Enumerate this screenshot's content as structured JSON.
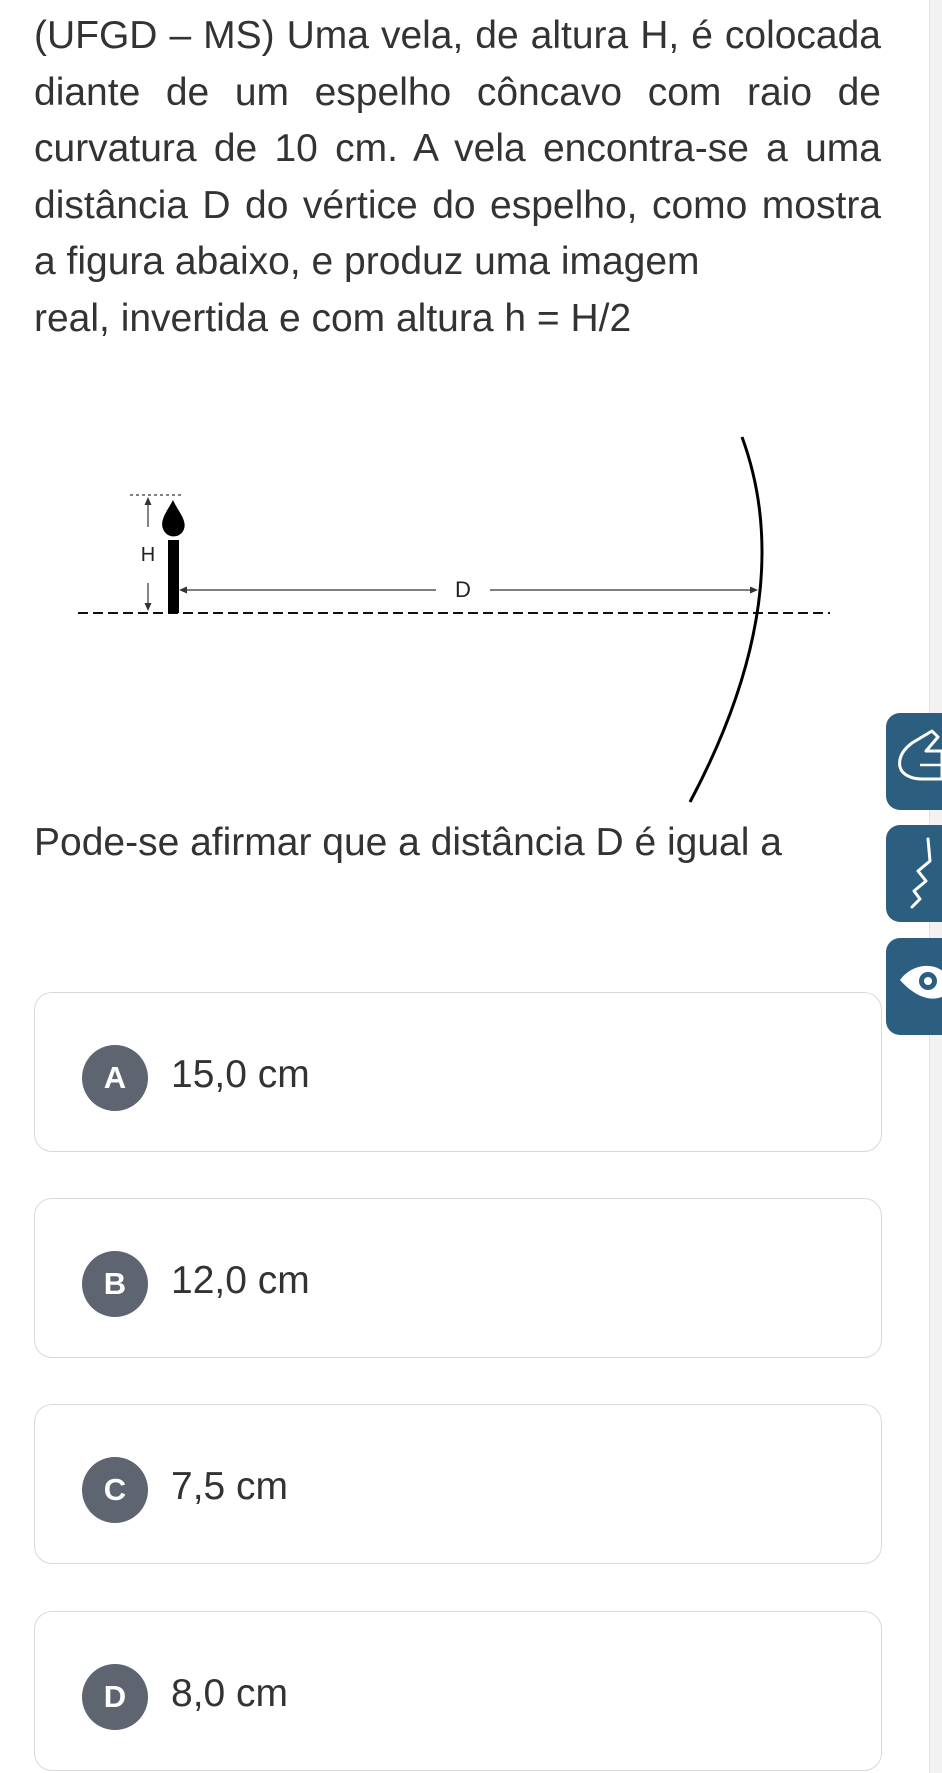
{
  "question": {
    "text": "(UFGD – MS) Uma vela, de altura H, é colocada diante de um espelho côncavo com raio de curvatura de 10 cm. A vela encontra-se a uma distância D do vértice do espelho, como mostra a figura abaixo, e produz uma imagem",
    "text_end": "real, invertida e com altura h = H/2"
  },
  "figure": {
    "height_label": "H",
    "distance_label": "D"
  },
  "prompt": "Pode-se afirmar que a distância D é igual a",
  "options": [
    {
      "letter": "A",
      "text": "15,0 cm"
    },
    {
      "letter": "B",
      "text": "12,0 cm"
    },
    {
      "letter": "C",
      "text": "7,5 cm"
    },
    {
      "letter": "D",
      "text": "8,0 cm"
    }
  ],
  "side_tools": [
    {
      "icon": "sign-language-icon"
    },
    {
      "icon": "audio-wave-icon"
    },
    {
      "icon": "eye-visibility-icon"
    }
  ],
  "colors": {
    "badge": "#5e6571",
    "side_tools": "#2c5f7f",
    "text": "#333333",
    "border": "#d9d9d9"
  }
}
